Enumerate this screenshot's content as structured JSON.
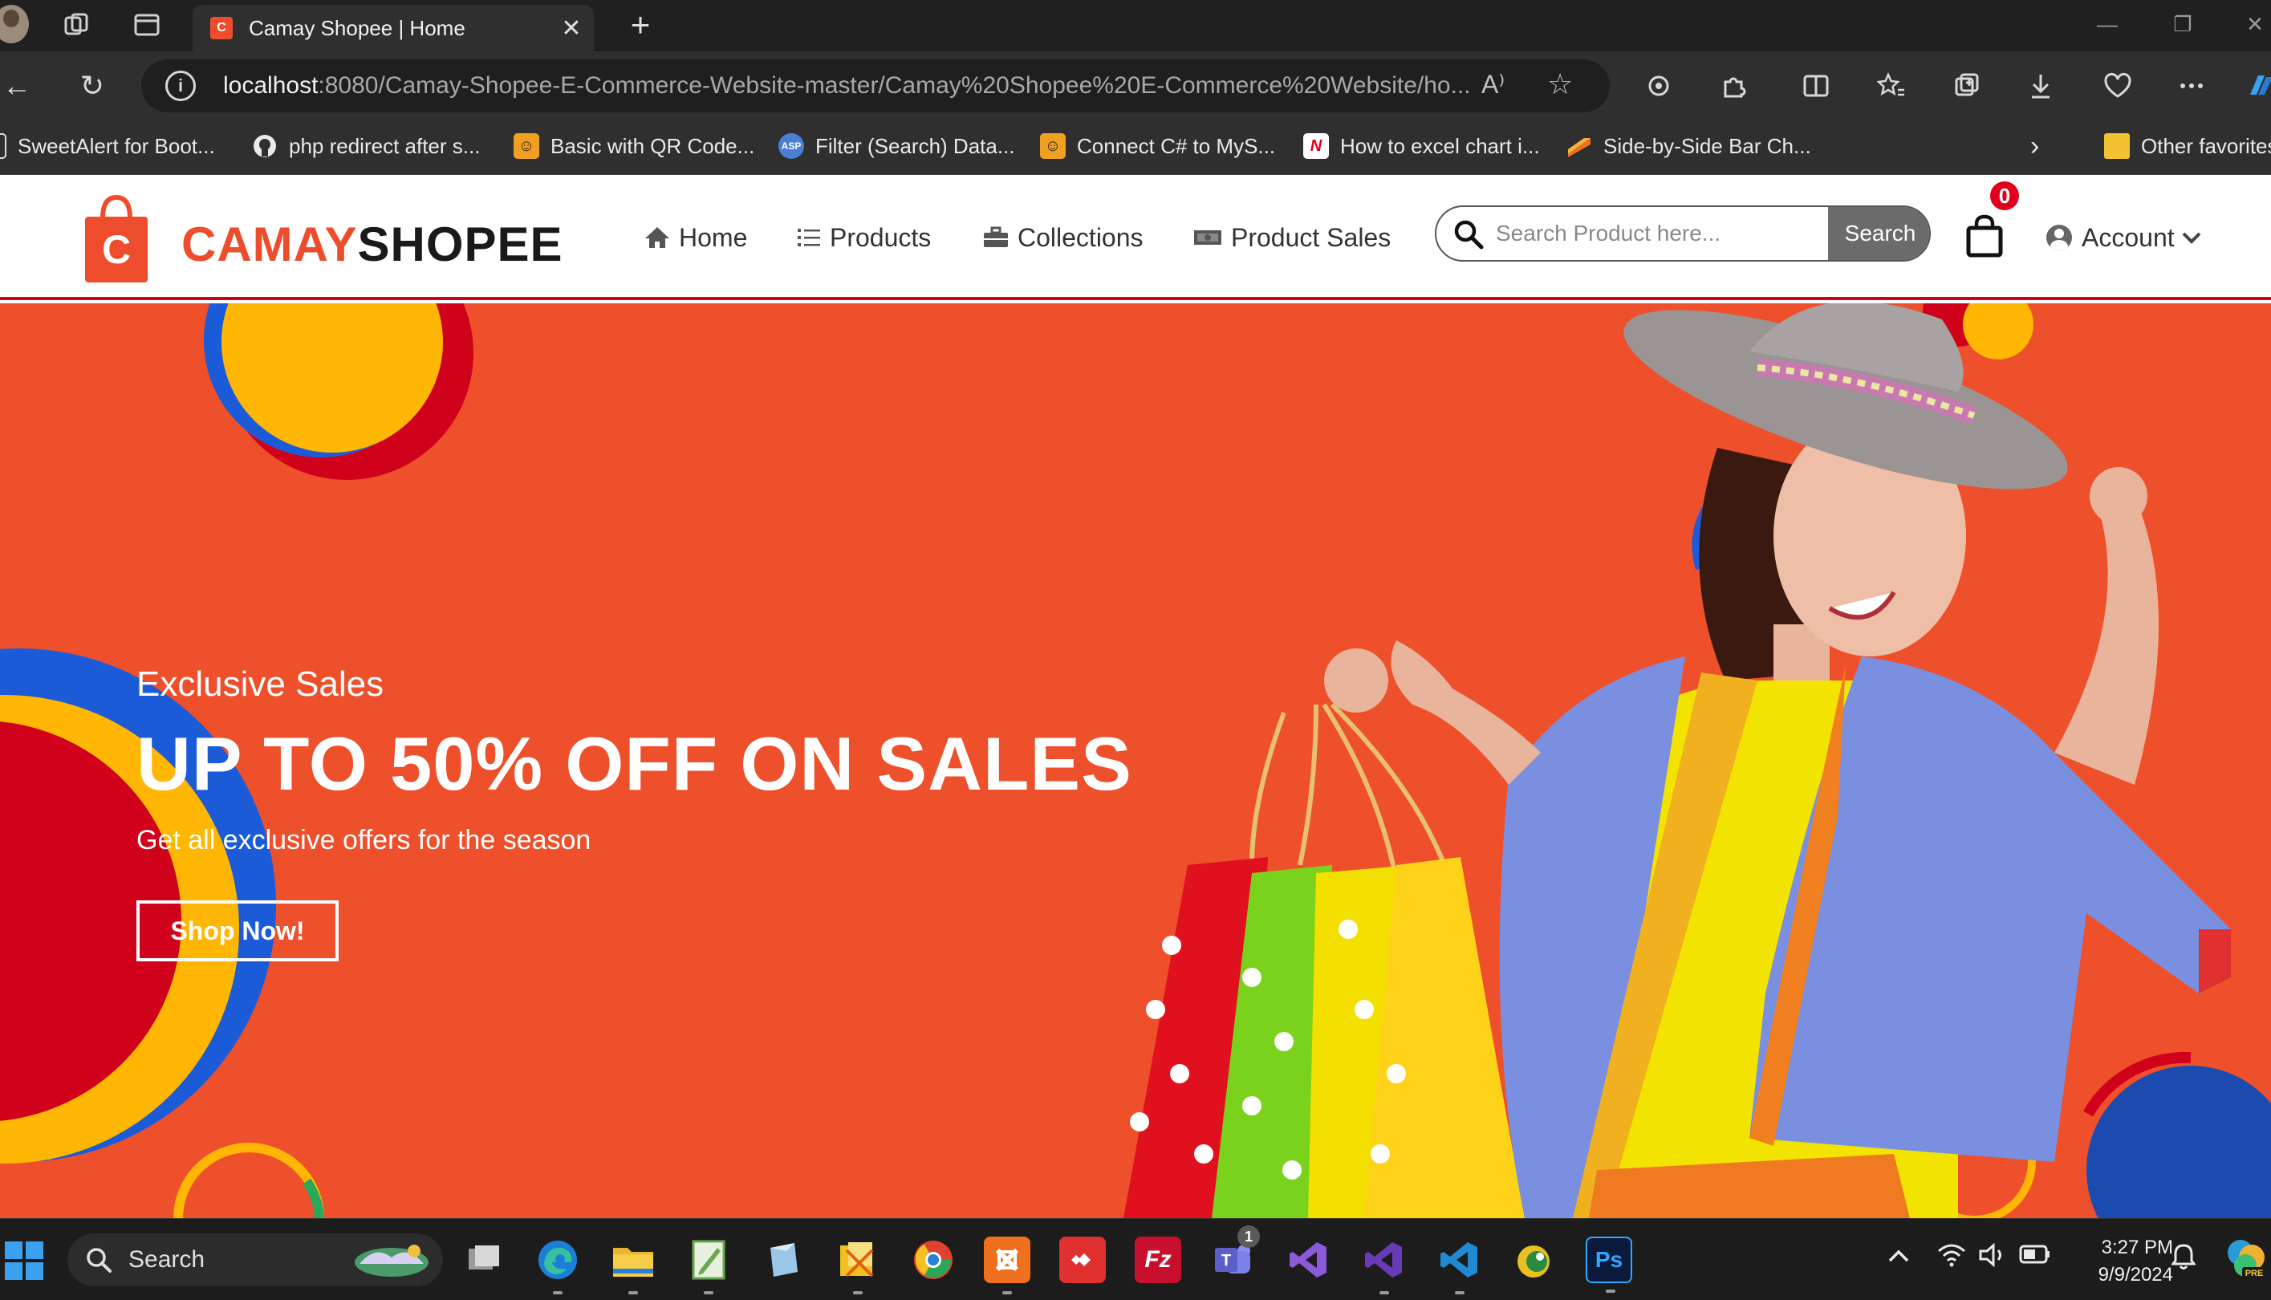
{
  "browser": {
    "tab": {
      "title": "Camay Shopee | Home",
      "close_glyph": "✕"
    },
    "new_tab_glyph": "+",
    "window_controls": [
      "—",
      "❐",
      "✕"
    ],
    "toolbar": {
      "back_glyph": "←",
      "refresh_glyph": "↻",
      "url_host": "localhost",
      "url_path": ":8080/Camay-Shopee-E-Commerce-Website-master/Camay%20Shopee%20E-Commerce%20Website/ho...",
      "info_glyph": "i",
      "read_aloud_glyph": "A⁾",
      "star_glyph": "☆",
      "icons": [
        "copilot-icon",
        "extensions-icon",
        "split-screen-icon",
        "favorites-icon",
        "collections-icon",
        "downloads-icon",
        "performance-icon",
        "more-icon"
      ]
    },
    "bookmarks": [
      {
        "label": "SweetAlert for Boot...",
        "icon": "page-icon",
        "color": "#2f2f2f"
      },
      {
        "label": "php redirect after s...",
        "icon": "github-icon",
        "color": "#2f2f2f"
      },
      {
        "label": "Basic with QR Code...",
        "icon": "codeproject-icon",
        "color": "#f0a020"
      },
      {
        "label": "Filter (Search) Data...",
        "icon": "aspnet-icon",
        "color": "#4a7fd4"
      },
      {
        "label": "Connect C# to MyS...",
        "icon": "codeproject-icon",
        "color": "#f0a020"
      },
      {
        "label": "How to excel chart i...",
        "icon": "n-icon",
        "color": "#e0001b"
      },
      {
        "label": "Side-by-Side Bar Ch...",
        "icon": "chart-icon",
        "color": "#f07020"
      }
    ],
    "bookmarks_more_glyph": "›",
    "other_favorites": "Other favorites"
  },
  "site": {
    "logo": {
      "part1": "CAMAY",
      "part2": "SHOPEE",
      "bag_letter": "C"
    },
    "nav": [
      {
        "label": "Home",
        "icon": "home-icon",
        "glyph": "⌂"
      },
      {
        "label": "Products",
        "icon": "list-icon",
        "glyph": "☰"
      },
      {
        "label": "Collections",
        "icon": "briefcase-icon",
        "glyph": "▣"
      },
      {
        "label": "Product Sales",
        "icon": "money-icon",
        "glyph": "▬"
      }
    ],
    "search": {
      "placeholder": "Search Product here...",
      "button": "Search"
    },
    "cart": {
      "count": "0"
    },
    "account": {
      "label": "Account",
      "chevron": "⌄"
    },
    "hero": {
      "eyebrow": "Exclusive Sales",
      "title": "UP TO 50% OFF ON SALES",
      "subtitle": "Get all exclusive offers for the season",
      "cta": "Shop Now!"
    },
    "colors": {
      "brand": "#ee4d2d",
      "hero_bg": "#ee502c",
      "accent_red": "#d0021b"
    }
  },
  "taskbar": {
    "search_label": "Search",
    "apps": [
      {
        "name": "task-view",
        "color": "#3a3a3a",
        "glyph": "▭"
      },
      {
        "name": "edge",
        "color": "#1b7fd8",
        "glyph": "e"
      },
      {
        "name": "file-explorer",
        "color": "#e8b530",
        "glyph": "▤"
      },
      {
        "name": "notepad-plus",
        "color": "#6aa84f",
        "glyph": "✎"
      },
      {
        "name": "virtualbox",
        "color": "#5a8fc0",
        "glyph": "◆"
      },
      {
        "name": "photo-app",
        "color": "#d8a020",
        "glyph": "✂"
      },
      {
        "name": "chrome",
        "color": "#e04030",
        "glyph": "◉"
      },
      {
        "name": "xampp",
        "color": "#f07020",
        "glyph": "ᛝ"
      },
      {
        "name": "anydesk",
        "color": "#e03030",
        "glyph": "◆"
      },
      {
        "name": "filezilla",
        "color": "#c8102e",
        "glyph": "Fz"
      },
      {
        "name": "teams",
        "color": "#5b5fc7",
        "glyph": "T"
      },
      {
        "name": "visual-studio",
        "color": "#7a4bc8",
        "glyph": "∞"
      },
      {
        "name": "visual-studio-2",
        "color": "#6a3bb8",
        "glyph": "∞"
      },
      {
        "name": "vs-code",
        "color": "#1f8ad2",
        "glyph": "≺"
      },
      {
        "name": "navicat",
        "color": "#6a8a30",
        "glyph": "◐"
      },
      {
        "name": "photoshop",
        "color": "#0b1a3a",
        "glyph": "Ps"
      }
    ],
    "teams_badge": "1",
    "tray": {
      "chevron": "^",
      "wifi": "◠",
      "volume": "◁)",
      "battery": "▭"
    },
    "clock_time": "3:27 PM",
    "clock_date": "9/9/2024",
    "bell_glyph": "🔔"
  }
}
